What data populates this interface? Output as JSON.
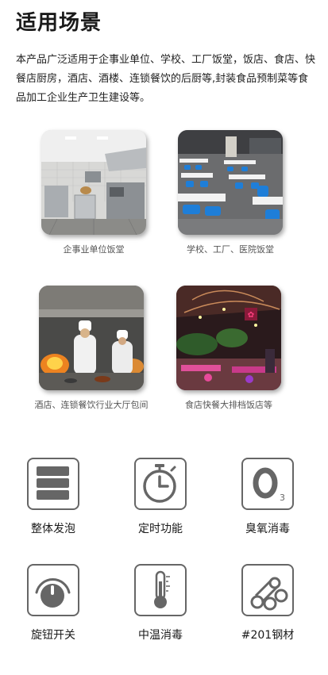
{
  "page": {
    "title": "适用场景",
    "description": "本产品广泛适用于企事业单位、学校、工厂饭堂，饭店、食店、快餐店厨房，酒店、酒楼、连锁餐饮的后厨等,封装食品预制菜等食品加工企业生产卫生建设等。"
  },
  "scenes": [
    {
      "caption": "企事业单位饭堂",
      "icon": "kitchen-photo"
    },
    {
      "caption": "学校、工厂、医院饭堂",
      "icon": "canteen-photo"
    },
    {
      "caption": "酒店、连锁餐饮行业大厅包间",
      "icon": "chefs-photo"
    },
    {
      "caption": "食店快餐大排档饭店等",
      "icon": "night-market-photo"
    }
  ],
  "features": [
    {
      "label": "整体发泡",
      "icon": "foam-layers-icon"
    },
    {
      "label": "定时功能",
      "icon": "stopwatch-icon"
    },
    {
      "label": "臭氧消毒",
      "icon": "ozone-icon",
      "symbol": "O",
      "subscript": "3"
    },
    {
      "label": "旋钮开关",
      "icon": "knob-icon"
    },
    {
      "label": "中温消毒",
      "icon": "thermometer-icon"
    },
    {
      "label": "#201钢材",
      "icon": "steel-pipes-icon"
    }
  ],
  "colors": {
    "icon_gray": "#666666",
    "text": "#1a1a1a",
    "caption": "#555555"
  }
}
